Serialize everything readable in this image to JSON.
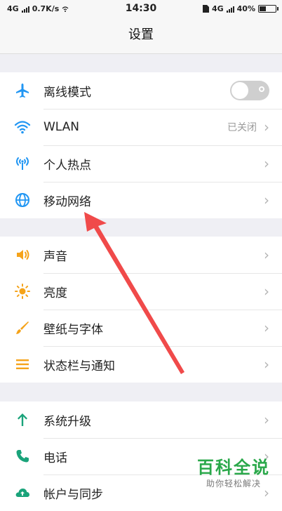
{
  "status_bar": {
    "network": "4G",
    "speed": "0.7K/s",
    "time": "14:30",
    "network_right": "4G",
    "battery": "40%"
  },
  "header": {
    "title": "设置"
  },
  "groups": [
    {
      "items": [
        {
          "label": "离线模式",
          "icon": "airplane-icon",
          "toggle": "off"
        },
        {
          "label": "WLAN",
          "icon": "wifi-icon",
          "value": "已关闭"
        },
        {
          "label": "个人热点",
          "icon": "hotspot-icon"
        },
        {
          "label": "移动网络",
          "icon": "globe-icon"
        }
      ]
    },
    {
      "items": [
        {
          "label": "声音",
          "icon": "speaker-icon"
        },
        {
          "label": "亮度",
          "icon": "brightness-icon"
        },
        {
          "label": "壁纸与字体",
          "icon": "brush-icon"
        },
        {
          "label": "状态栏与通知",
          "icon": "list-icon"
        }
      ]
    },
    {
      "items": [
        {
          "label": "系统升级",
          "icon": "arrow-up-icon"
        },
        {
          "label": "电话",
          "icon": "phone-icon"
        },
        {
          "label": "帐户与同步",
          "icon": "cloud-sync-icon"
        }
      ]
    }
  ],
  "watermark": {
    "main": "百科全说",
    "sub": "助你轻松解决"
  },
  "colors": {
    "accent_blue": "#2196f3",
    "accent_orange": "#f5a31a",
    "accent_green": "#1aa37a",
    "arrow_red": "#f04a4a"
  }
}
